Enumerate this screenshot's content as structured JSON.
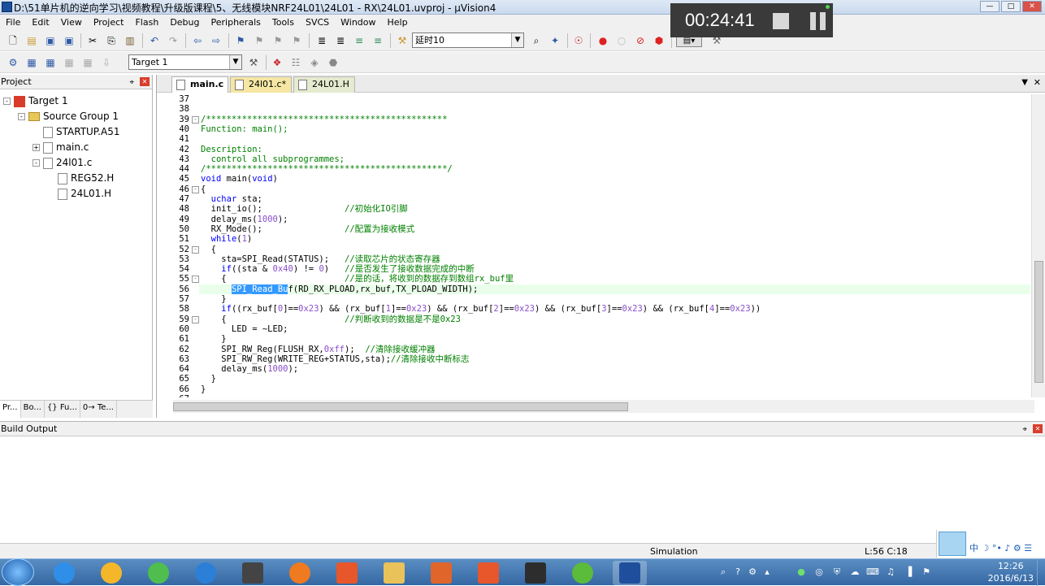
{
  "window": {
    "title": "D:\\51单片机的逆向学习\\视频教程\\升级版课程\\5、无线模块NRF24L01\\24L01 - RX\\24L01.uvproj - µVision4"
  },
  "menu": [
    "File",
    "Edit",
    "View",
    "Project",
    "Flash",
    "Debug",
    "Peripherals",
    "Tools",
    "SVCS",
    "Window",
    "Help"
  ],
  "toolbar": {
    "find_combo": "延时10",
    "target_combo": "Target 1"
  },
  "recorder": {
    "time": "00:24:41"
  },
  "project_panel": {
    "title": "Project",
    "tree": [
      "Target 1",
      "Source Group 1",
      "STARTUP.A51",
      "main.c",
      "24l01.c",
      "REG52.H",
      "24L01.H"
    ],
    "tabs": [
      "Pr...",
      "Bo...",
      "{} Fu...",
      "0→ Te..."
    ]
  },
  "editor_tabs": [
    "main.c",
    "24l01.c*",
    "24L01.H"
  ],
  "code": {
    "line_numbers": [
      "37",
      "38",
      "39",
      "40",
      "41",
      "42",
      "43",
      "44",
      "45",
      "46",
      "47",
      "48",
      "49",
      "50",
      "51",
      "52",
      "53",
      "54",
      "55",
      "56",
      "57",
      "58",
      "59",
      "60",
      "61",
      "62",
      "63",
      "64",
      "65",
      "66",
      "67"
    ],
    "lines": [
      "",
      "",
      "/***********************************************",
      "Function: main();",
      "",
      "Description:",
      "  control all subprogrammes;",
      "/***********************************************/",
      "void main(void)",
      "{",
      "  uchar sta;",
      "  init_io();                //初始化IO引脚",
      "  delay_ms(1000);",
      "  RX_Mode();                //配置为接收模式",
      "  while(1)",
      "  {",
      "    sta=SPI_Read(STATUS);   //读取芯片的状态寄存器",
      "    if((sta & 0x40) != 0)   //是否发生了接收数据完成的中断",
      "    {                       //是的话，将收到的数据存到数组rx_buf里",
      "      SPI_Read_Buf(RD_RX_PLOAD,rx_buf,TX_PLOAD_WIDTH);",
      "    }",
      "    if((rx_buf[0]==0x23) && (rx_buf[1]==0x23) && (rx_buf[2]==0x23) && (rx_buf[3]==0x23) && (rx_buf[4]==0x23))",
      "    {                       //判断收到的数据是不是0x23",
      "      LED = ~LED;",
      "    }",
      "    SPI_RW_Reg(FLUSH_RX,0xff);  //清除接收缓冲器",
      "    SPI_RW_Reg(WRITE_REG+STATUS,sta);//清除接收中断标志",
      "    delay_ms(1000);",
      "  }",
      "}",
      ""
    ]
  },
  "build_output": {
    "title": "Build Output"
  },
  "status": {
    "mode": "Simulation",
    "position": "L:56 C:18"
  },
  "ime": {
    "label": "中 ☽ °• ♪ ⚙ ☰"
  },
  "tray": {
    "time": "12:26",
    "date": "2016/6/13"
  },
  "colors": {
    "comment": "#008000",
    "keyword": "#0000ff",
    "number": "#8a4fc9",
    "selection": "#3399ff"
  }
}
